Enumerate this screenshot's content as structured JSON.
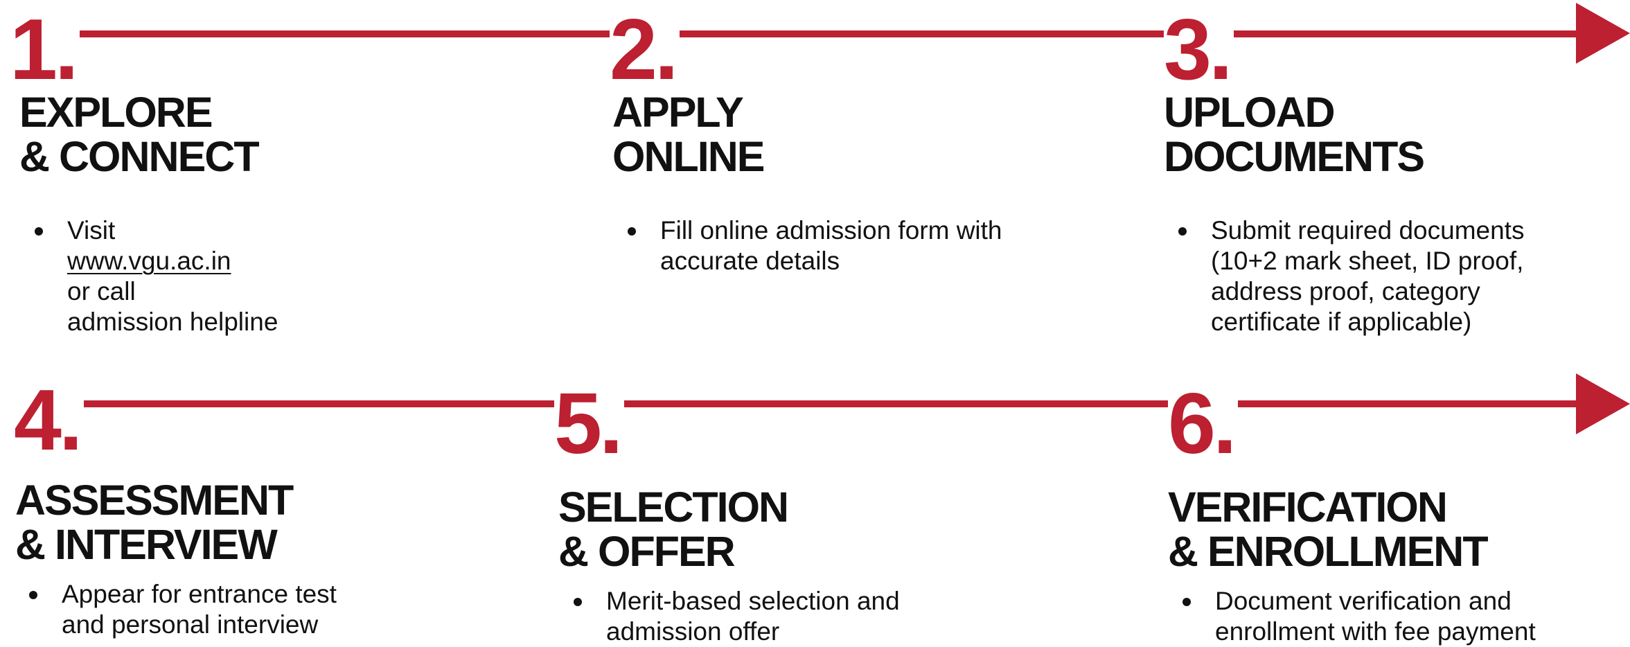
{
  "accent_color": "#BC2031",
  "steps": [
    {
      "number": "1.",
      "title_line1": "EXPLORE",
      "title_line2": "& CONNECT",
      "bullet": {
        "prefix": "Visit ",
        "link": "www.vgu.ac.in",
        "suffix": " or call",
        "line2": "admission helpline"
      }
    },
    {
      "number": "2.",
      "title_line1": "APPLY",
      "title_line2": "ONLINE",
      "bullet": {
        "line1": "Fill online admission form with",
        "line2": "accurate details"
      }
    },
    {
      "number": "3.",
      "title_line1": "UPLOAD",
      "title_line2": "DOCUMENTS",
      "bullet": {
        "line1": "Submit required documents",
        "line2": "(10+2 mark sheet, ID proof,",
        "line3": "address proof, category",
        "line4": "certificate if applicable)"
      }
    },
    {
      "number": "4.",
      "title_line1": "ASSESSMENT",
      "title_line2": "& INTERVIEW",
      "bullet": {
        "line1": "Appear for entrance test",
        "line2": "and personal interview"
      }
    },
    {
      "number": "5.",
      "title_line1": "SELECTION",
      "title_line2": "& OFFER",
      "bullet": {
        "line1": "Merit-based selection and",
        "line2": "admission offer"
      }
    },
    {
      "number": "6.",
      "title_line1": "VERIFICATION",
      "title_line2": "& ENROLLMENT",
      "bullet": {
        "line1": "Document verification and",
        "line2": "enrollment with fee payment"
      }
    }
  ]
}
